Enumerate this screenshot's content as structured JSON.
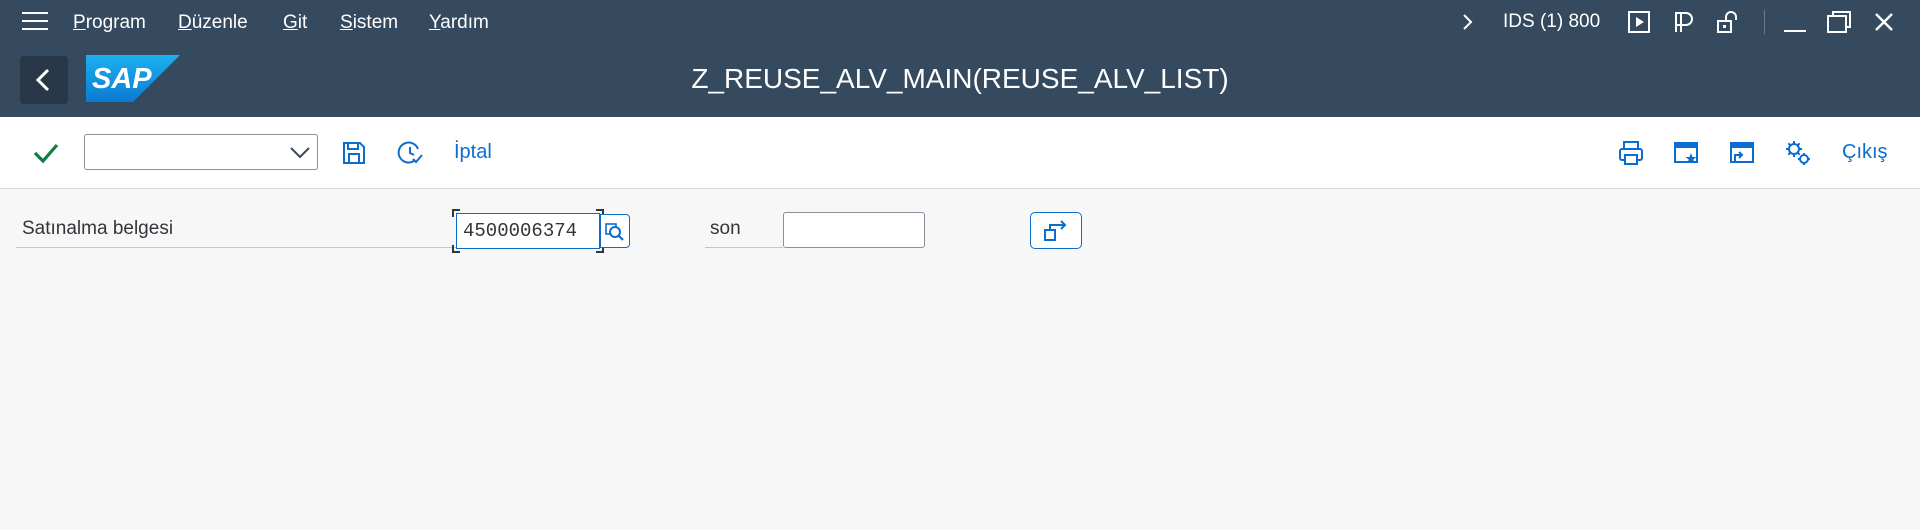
{
  "menu": {
    "items": [
      {
        "underline": "P",
        "rest": "rogram"
      },
      {
        "underline": "D",
        "rest": "üzenle"
      },
      {
        "underline": "G",
        "rest": "it"
      },
      {
        "underline": "S",
        "rest": "istem"
      },
      {
        "underline": "Y",
        "rest": "ardım"
      }
    ],
    "system_info": "IDS (1) 800"
  },
  "titlebar": {
    "title": "Z_REUSE_ALV_MAIN(REUSE_ALV_LIST)",
    "logo_text": "SAP"
  },
  "toolbar": {
    "command_field_value": "",
    "cancel_label": "İptal",
    "exit_label": "Çıkış"
  },
  "form": {
    "field_label": "Satınalma belgesi",
    "from_value": "4500006374",
    "to_label": "son",
    "to_value": ""
  },
  "colors": {
    "header_bg": "#354a5f",
    "accent": "#0a6ed1",
    "check_green": "#107e3e",
    "body_bg": "#f7f7f7"
  }
}
